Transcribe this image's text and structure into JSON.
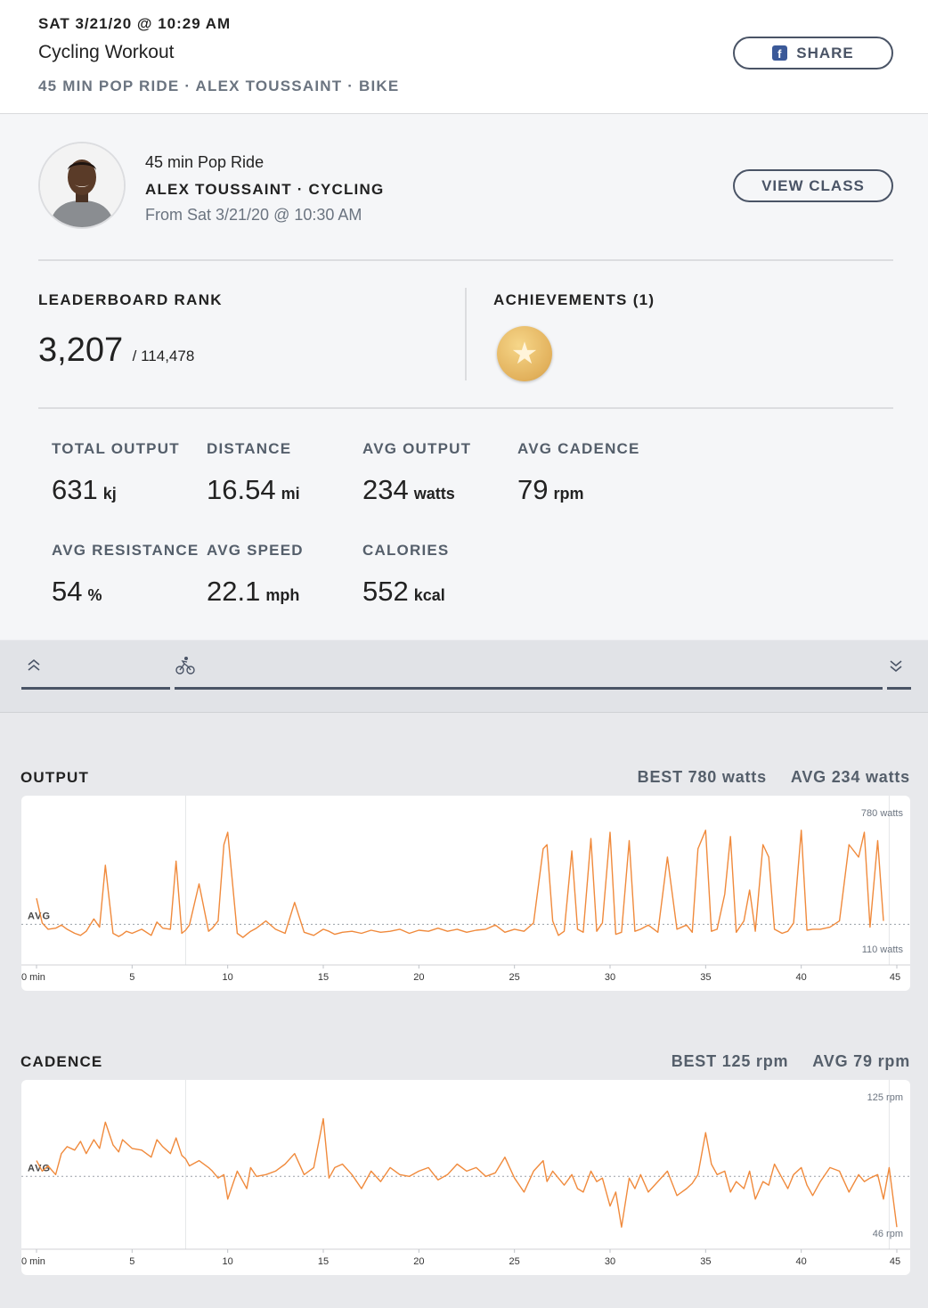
{
  "header": {
    "date": "SAT 3/21/20 @ 10:29 AM",
    "title": "Cycling Workout",
    "subtitle": "45 MIN POP RIDE · ALEX TOUSSAINT · BIKE",
    "share_label": "SHARE"
  },
  "class": {
    "name": "45 min Pop Ride",
    "instructor_line": "ALEX TOUSSAINT · CYCLING",
    "from": "From Sat 3/21/20 @ 10:30 AM",
    "view_label": "VIEW CLASS"
  },
  "leaderboard": {
    "label": "LEADERBOARD RANK",
    "rank": "3,207",
    "total": "/ 114,478"
  },
  "achievements": {
    "label": "ACHIEVEMENTS (1)",
    "icon": "star-medal-icon"
  },
  "stats": [
    {
      "label": "TOTAL OUTPUT",
      "value": "631",
      "unit": "kj"
    },
    {
      "label": "DISTANCE",
      "value": "16.54",
      "unit": "mi"
    },
    {
      "label": "AVG OUTPUT",
      "value": "234",
      "unit": "watts"
    },
    {
      "label": "AVG CADENCE",
      "value": "79",
      "unit": "rpm"
    },
    {
      "label": "AVG RESISTANCE",
      "value": "54",
      "unit": "%"
    },
    {
      "label": "AVG SPEED",
      "value": "22.1",
      "unit": "mph"
    },
    {
      "label": "CALORIES",
      "value": "552",
      "unit": "kcal"
    }
  ],
  "tabs": {
    "icons": [
      "chevrons-up-icon",
      "cyclist-icon",
      "chevrons-down-icon"
    ]
  },
  "colors": {
    "line": "#f08a3c",
    "button": "#4a5466",
    "facebook": "#3b5998"
  },
  "output": {
    "title": "OUTPUT",
    "best": "BEST 780 watts",
    "avg": "AVG 234 watts"
  },
  "cadence": {
    "title": "CADENCE",
    "best": "BEST 125 rpm",
    "avg": "AVG 79 rpm"
  },
  "chart_data": [
    {
      "type": "line",
      "name": "OUTPUT",
      "xlabel": "min",
      "x_ticks": [
        "0 min",
        "5",
        "10",
        "15",
        "20",
        "25",
        "30",
        "35",
        "40",
        "45"
      ],
      "ylim": [
        110,
        780
      ],
      "top_label": "780 watts",
      "bottom_label": "110 watts",
      "avg_label": "AVG",
      "avg": 234,
      "x": [
        0,
        0.3,
        0.6,
        1,
        1.3,
        1.6,
        2,
        2.3,
        2.6,
        3,
        3.3,
        3.6,
        4,
        4.3,
        4.5,
        4.7,
        5,
        5.5,
        6,
        6.3,
        6.6,
        7,
        7.3,
        7.6,
        7.8,
        8,
        8.5,
        9,
        9.2,
        9.5,
        9.8,
        10,
        10.5,
        10.8,
        11,
        11.2,
        11.5,
        12,
        12.5,
        13,
        13.5,
        14,
        14.5,
        15,
        15.3,
        15.6,
        16,
        16.5,
        17,
        17.5,
        18,
        18.5,
        19,
        19.5,
        20,
        20.5,
        21,
        21.5,
        22,
        22.5,
        23,
        23.5,
        24,
        24.5,
        25,
        25.5,
        26,
        26.5,
        26.7,
        27,
        27.3,
        27.6,
        28,
        28.3,
        28.6,
        29,
        29.3,
        29.6,
        30,
        30.3,
        30.6,
        31,
        31.3,
        31.6,
        32,
        32.5,
        33,
        33.5,
        34,
        34.3,
        34.6,
        35,
        35.3,
        35.6,
        36,
        36.3,
        36.6,
        37,
        37.3,
        37.6,
        38,
        38.3,
        38.6,
        39,
        39.3,
        39.6,
        40,
        40.3,
        40.6,
        41,
        41.5,
        42,
        42.5,
        43,
        43.3,
        43.6,
        44,
        44.3,
        44.6,
        45
      ],
      "y": [
        360,
        240,
        210,
        215,
        230,
        210,
        190,
        180,
        200,
        260,
        220,
        520,
        190,
        175,
        185,
        200,
        190,
        210,
        180,
        245,
        215,
        210,
        540,
        190,
        205,
        230,
        430,
        200,
        215,
        250,
        620,
        680,
        190,
        170,
        185,
        200,
        215,
        250,
        210,
        190,
        340,
        195,
        180,
        210,
        200,
        185,
        195,
        200,
        190,
        205,
        195,
        200,
        210,
        190,
        205,
        200,
        215,
        200,
        210,
        195,
        205,
        210,
        230,
        195,
        210,
        200,
        240,
        600,
        620,
        250,
        180,
        200,
        590,
        210,
        195,
        650,
        200,
        240,
        680,
        185,
        195,
        640,
        200,
        210,
        230,
        195,
        560,
        210,
        230,
        195,
        600,
        690,
        200,
        210,
        380,
        660,
        195,
        250,
        400,
        200,
        620,
        560,
        210,
        190,
        200,
        240,
        690,
        205,
        210,
        210,
        220,
        250,
        620,
        560,
        680,
        220,
        640,
        250
      ],
      "series": [
        {
          "name": "Output"
        }
      ]
    },
    {
      "type": "line",
      "name": "CADENCE",
      "xlabel": "min",
      "x_ticks": [
        "0 min",
        "5",
        "10",
        "15",
        "20",
        "25",
        "30",
        "35",
        "40",
        "45"
      ],
      "ylim": [
        46,
        125
      ],
      "top_label": "125 rpm",
      "bottom_label": "46 rpm",
      "avg_label": "AVG",
      "avg": 79,
      "x": [
        0,
        0.3,
        0.6,
        1,
        1.3,
        1.6,
        2,
        2.3,
        2.6,
        3,
        3.3,
        3.6,
        4,
        4.3,
        4.5,
        4.7,
        5,
        5.5,
        6,
        6.3,
        6.6,
        7,
        7.3,
        7.6,
        7.8,
        8,
        8.5,
        9,
        9.2,
        9.5,
        9.8,
        10,
        10.5,
        10.8,
        11,
        11.2,
        11.5,
        12,
        12.5,
        13,
        13.5,
        14,
        14.5,
        15,
        15.3,
        15.6,
        16,
        16.5,
        17,
        17.5,
        18,
        18.5,
        19,
        19.5,
        20,
        20.5,
        21,
        21.5,
        22,
        22.5,
        23,
        23.5,
        24,
        24.5,
        25,
        25.5,
        26,
        26.5,
        26.7,
        27,
        27.3,
        27.6,
        28,
        28.3,
        28.6,
        29,
        29.3,
        29.6,
        30,
        30.3,
        30.6,
        31,
        31.3,
        31.6,
        32,
        32.5,
        33,
        33.5,
        34,
        34.3,
        34.6,
        35,
        35.3,
        35.6,
        36,
        36.3,
        36.6,
        37,
        37.3,
        37.6,
        38,
        38.3,
        38.6,
        39,
        39.3,
        39.6,
        40,
        40.3,
        40.6,
        41,
        41.5,
        42,
        42.5,
        43,
        43.3,
        43.6,
        44,
        44.3,
        44.6,
        45
      ],
      "y": [
        88,
        82,
        85,
        80,
        92,
        96,
        94,
        99,
        92,
        100,
        95,
        110,
        97,
        93,
        100,
        98,
        95,
        94,
        90,
        100,
        96,
        92,
        101,
        91,
        89,
        85,
        88,
        84,
        82,
        78,
        80,
        66,
        82,
        76,
        72,
        84,
        79,
        80,
        82,
        86,
        92,
        80,
        84,
        112,
        78,
        84,
        86,
        80,
        72,
        82,
        76,
        84,
        80,
        79,
        82,
        84,
        77,
        80,
        86,
        82,
        84,
        79,
        81,
        90,
        78,
        70,
        82,
        88,
        76,
        82,
        78,
        74,
        80,
        72,
        70,
        82,
        76,
        78,
        62,
        70,
        50,
        78,
        72,
        80,
        70,
        76,
        82,
        68,
        72,
        75,
        80,
        104,
        86,
        80,
        82,
        70,
        76,
        72,
        82,
        66,
        76,
        74,
        86,
        78,
        72,
        80,
        84,
        74,
        68,
        76,
        84,
        82,
        70,
        80,
        76,
        78,
        80,
        66,
        84,
        50
      ]
    }
  ]
}
